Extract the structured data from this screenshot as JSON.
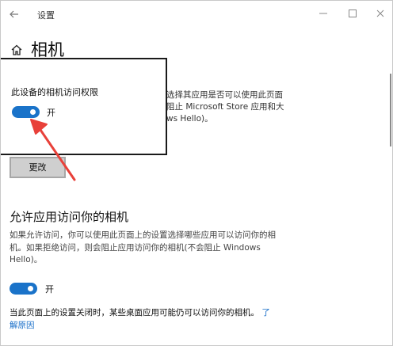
{
  "window": {
    "title": "设置",
    "back_icon": "back-arrow-icon",
    "controls": [
      "minimize-icon",
      "maximize-icon",
      "close-icon"
    ]
  },
  "page": {
    "title": "相机",
    "home_icon": "home-icon"
  },
  "device_access": {
    "description_lines": [
      "选择其应用是否可以使用此页面",
      "阻止 Microsoft Store 应用和大",
      "ws Hello)。"
    ],
    "change_button": "更改"
  },
  "popup": {
    "title": "此设备的相机访问权限",
    "toggle_label": "开",
    "toggle_on": true
  },
  "app_access": {
    "title": "允许应用访问你的相机",
    "description_lines": [
      "如果允许访问，你可以使用此页面上的设置选择哪些应用可以访问你的相",
      "机。如果拒绝访问，则会阻止应用访问你的相机(不会阻止 Windows",
      "Hello)。"
    ],
    "toggle_label": "开",
    "toggle_on": true,
    "note_text": "当此页面上的设置关闭时，某些桌面应用可能仍可以访问你的相机。",
    "note_link_1": "了",
    "note_link_2": "解原因"
  },
  "colors": {
    "accent": "#1a73c9",
    "annotation_red": "#e8413a",
    "button_bg": "#cfcfcf"
  }
}
